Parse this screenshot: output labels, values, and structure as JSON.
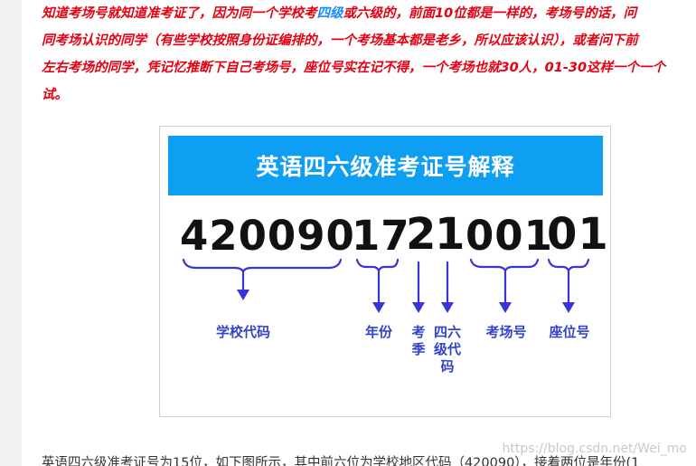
{
  "paragraph": {
    "line1_a": "知道考场号就知道准考证了，因为同一个学校考",
    "line1_link": "四级",
    "line1_b": "或六级的，前面10位都是一样的，考场号的话，问",
    "line2": "同考场认识的同学（有些学校按照身份证编排的，一个考场基本都是老乡，所以应该认识），或者问下前",
    "line3": "左右考场的同学，凭记忆推断下自己考场号，座位号实在记不得，一个考场也就30人，01-30这样一个一个",
    "line4": "试。"
  },
  "figure": {
    "banner_title": "英语四六级准考证号解释",
    "groups": [
      {
        "digits": "420090",
        "label": "学校代码"
      },
      {
        "digits": "17",
        "label": "年份"
      },
      {
        "digits": "2",
        "label": "考季"
      },
      {
        "digits": "1",
        "label": "四六级代码"
      },
      {
        "digits": "001",
        "label": "考场号"
      },
      {
        "digits": "01",
        "label": "座位号"
      }
    ]
  },
  "bottom_text": "英语四六级准考证号为15位，如下图所示，其中前六位为学校地区代码（420090），接着两位是年份(1",
  "watermark": "https://blog.csdn.net/Wei_mo",
  "colors": {
    "red_text": "#e60012",
    "link": "#1a8cff",
    "banner": "#0e9ef2",
    "labels": "#3344cc",
    "braces": "#3a33d6"
  }
}
